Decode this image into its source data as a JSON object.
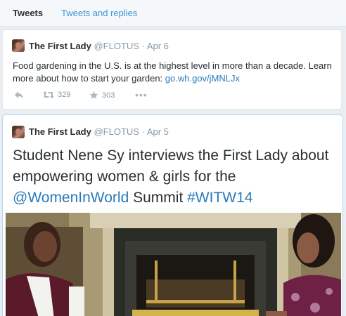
{
  "tabs": {
    "tweets": "Tweets",
    "replies": "Tweets and replies"
  },
  "tweet1": {
    "name": "The First Lady",
    "handle": "@FLOTUS",
    "sep": "·",
    "date": "Apr 6",
    "text": "Food gardening in the U.S. is at the highest level in more than a decade. Learn more about how to start your garden: ",
    "link": "go.wh.gov/jMNLJx",
    "retweets": "329",
    "favorites": "303"
  },
  "tweet2": {
    "name": "The First Lady",
    "handle": "@FLOTUS",
    "sep": "·",
    "date": "Apr 5",
    "text_part1": "Student Nene Sy interviews the First Lady about empowering women & girls for the ",
    "mention": "@WomenInWorld",
    "text_part2": " Summit ",
    "hashtag": "#WITW14"
  },
  "colors": {
    "link": "#2b7bb9",
    "tab_link": "#3b94d9",
    "muted": "#8899a6"
  }
}
